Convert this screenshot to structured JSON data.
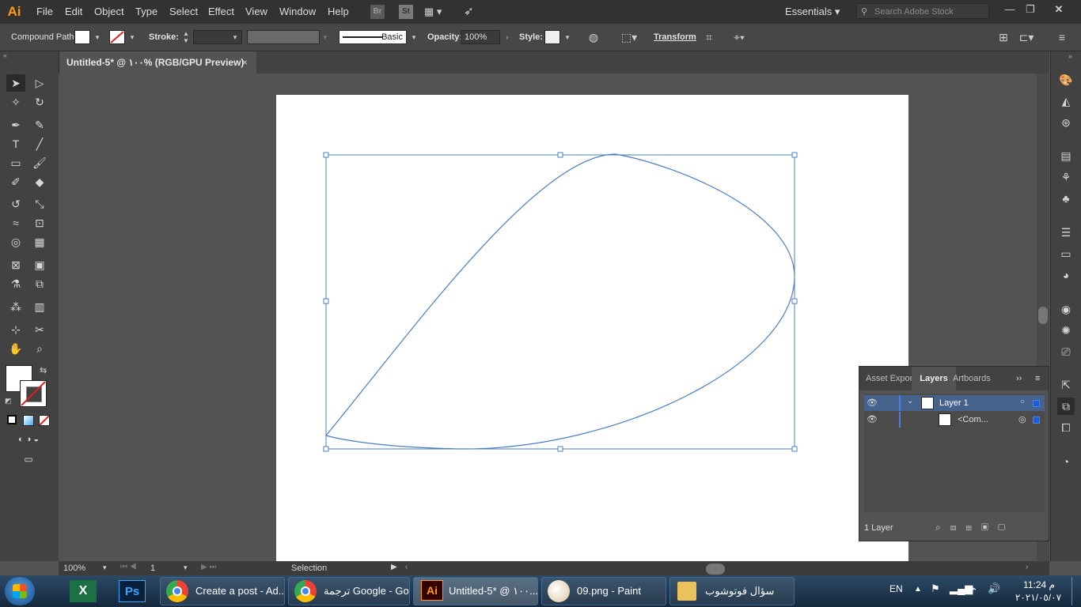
{
  "menu": {
    "logo": "Ai",
    "items": [
      "File",
      "Edit",
      "Object",
      "Type",
      "Select",
      "Effect",
      "View",
      "Window",
      "Help"
    ],
    "bridge": "Br",
    "stock": "St",
    "workspace": "Essentials",
    "search_placeholder": "Search Adobe Stock"
  },
  "control": {
    "selection_type": "Compound Path",
    "stroke_label": "Stroke:",
    "brush_label": "Basic",
    "opacity_label": "Opacity:",
    "opacity_value": "100%",
    "style_label": "Style:",
    "transform_label": "Transform"
  },
  "document": {
    "tab_title": "Untitled-5* @ ١٠٠% (RGB/GPU Preview)",
    "close": "×"
  },
  "layers_panel": {
    "tabs": [
      "Asset Expor",
      "Layers",
      "Artboards"
    ],
    "layer_name": "Layer 1",
    "sublayer_name": "<Com...",
    "count": "1 Layer"
  },
  "status": {
    "zoom": "100%",
    "artboard_num": "1",
    "tool_name": "Selection"
  },
  "taskbar": {
    "buttons": [
      {
        "label": "Create a post - Ad..."
      },
      {
        "label": "ترجمة Google - Go..."
      },
      {
        "label": "Untitled-5* @ ١٠٠..."
      },
      {
        "label": "09.png - Paint"
      },
      {
        "label": "سؤال فوتوشوب"
      }
    ],
    "lang": "EN",
    "time": "11:24 م",
    "date": "٢٠٢١/٠٥/٠٧"
  },
  "colors": {
    "accent": "#4a7fc1",
    "app_bg": "#535353",
    "path_stroke": "#4a7fc1"
  }
}
